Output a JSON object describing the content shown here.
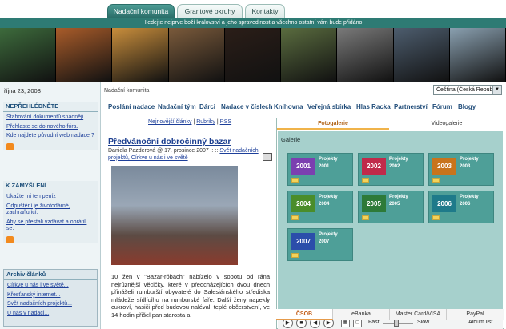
{
  "tabs": [
    {
      "label": "Nadační komunita",
      "active": true
    },
    {
      "label": "Grantové okruhy",
      "active": false
    },
    {
      "label": "Kontakty",
      "active": false
    }
  ],
  "banner": {
    "motto": "Hledejte nejprve boží království a jeho spravedlnost a všechno ostatní vám bude přidáno."
  },
  "photos": {
    "colors": [
      "#3d6b3c",
      "#a95c2a",
      "#c98e3c",
      "#7a5a3b",
      "#2b1e18",
      "#5a6c3f",
      "#7a7a7a",
      "#4d5d6e",
      "#8aa0b0"
    ]
  },
  "sidebar": {
    "date": "října 23, 2008",
    "box1": {
      "title": "NEPŘEHLÉDNĚTE",
      "links": [
        "Stahování dokumentů snadněji",
        "Přehlaste se do nového fóra.",
        "Kde najdete původní web nadace ?"
      ]
    },
    "box2": {
      "title": "K ZAMYŠLENÍ",
      "links": [
        "Ukažte mi ten peníz",
        "Odpuštění je životodárné, zachraňující.",
        "Aby se přestali vzdávat a obrátili se."
      ]
    },
    "archive": {
      "title": "Archiv článků",
      "links": [
        "Církve u nás i ve světě...",
        "Křesťanský internet...",
        "Svět nadačních projektů...",
        "U nás v nadaci..."
      ]
    }
  },
  "header": {
    "breadcrumb": "Nadační komunita",
    "language": "Čeština (Česká Republi"
  },
  "nav": [
    "Poslání nadace",
    "Nadační tým",
    "Dárci",
    "Nadace v číslech",
    "Knihovna",
    "Veřejná sbírka",
    "Hlas Racka",
    "Partnerství",
    "Fórum",
    "Blogy"
  ],
  "sublinks": {
    "newest": "Nejnovější články",
    "sep1": "|",
    "rubrics": "Rubriky",
    "sep2": "|",
    "rss": "RSS"
  },
  "article": {
    "title": "Předvánoční dobročinný bazar",
    "meta_prefix": "Daniela Pazderová @ 17. prosince 2007 :: ::",
    "meta_links": "Svět nadačních projektů, Církve u nás i ve světě",
    "body": "10 žen v \"Bazar-róbách\" nabízelo v sobotu od rána nejrůznější věcičky, které v předcházejících dvou dnech přinášeli rumburští obyvatelé do Salesiánského střediska mládeže sídlícího na rumburské faře. Další ženy napekly cukroví, hasiči před budovou nalévali teplé občerstvení, ve 14 hodin přišel pan starosta a"
  },
  "gallery": {
    "tab_photo": "Fotogalerie",
    "tab_video": "Videogalerie",
    "label": "Galerie",
    "items": [
      {
        "year": "2001",
        "title": "Projekty",
        "sub": "2001",
        "color": "#7b3fb0"
      },
      {
        "year": "2002",
        "title": "Projekty",
        "sub": "2002",
        "color": "#c02a4a"
      },
      {
        "year": "2003",
        "title": "Projekty",
        "sub": "2003",
        "color": "#c8741c"
      },
      {
        "year": "2004",
        "title": "Projekty",
        "sub": "2004",
        "color": "#4a8d2a"
      },
      {
        "year": "2005",
        "title": "Projekty",
        "sub": "2005",
        "color": "#2d7a38"
      },
      {
        "year": "2006",
        "title": "Projekty",
        "sub": "2006",
        "color": "#1e7a8a"
      },
      {
        "year": "2007",
        "title": "Projekty",
        "sub": "2007",
        "color": "#2b4eaa"
      }
    ],
    "controls": {
      "fast": "Fast",
      "slow": "Slow",
      "album": "Album list"
    }
  },
  "payments": [
    "ČSOB",
    "eBanka",
    "Master Card/VISA",
    "PayPal"
  ]
}
